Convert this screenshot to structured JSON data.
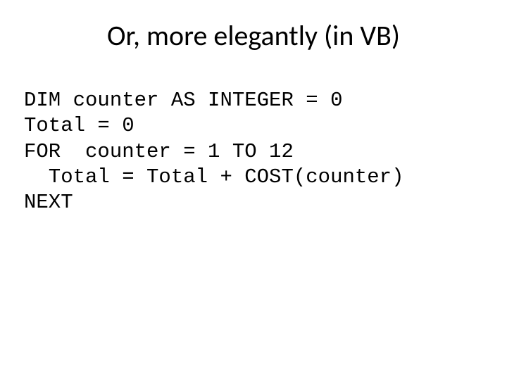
{
  "title": "Or, more elegantly (in VB)",
  "code": {
    "line1": "DIM counter AS INTEGER = 0",
    "line2": "Total = 0",
    "line3": "FOR  counter = 1 TO 12",
    "line4": "  Total = Total + COST(counter)",
    "line5": "NEXT"
  }
}
